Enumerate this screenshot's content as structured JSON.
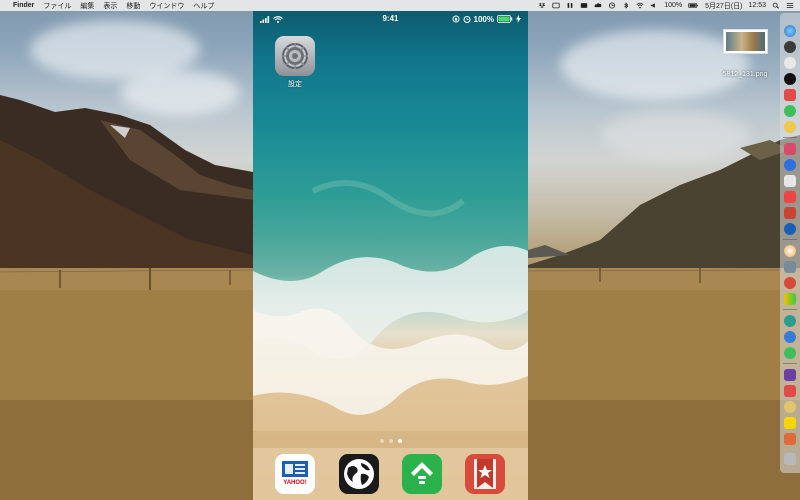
{
  "menubar": {
    "apple": "",
    "app_name": "Finder",
    "menus": [
      "ファイル",
      "編集",
      "表示",
      "移動",
      "ウインドウ",
      "ヘルプ"
    ],
    "battery": "100%",
    "date": "5月27日(日)",
    "time": "12:53"
  },
  "simulator": {
    "status_time": "9:41",
    "battery": "100%",
    "apps": [
      {
        "label": "設定",
        "icon": "settings-gear-icon"
      }
    ],
    "page_dots": 3,
    "active_page": 2,
    "dock_apps": [
      {
        "name": "yahoo-japan-icon",
        "text": "YAHOO!"
      },
      {
        "name": "globe-icon"
      },
      {
        "name": "feedly-icon"
      },
      {
        "name": "wunderlist-icon"
      }
    ]
  },
  "desktop": {
    "file_label": "5812_131.png"
  },
  "colors": {
    "menubar_bg": "#ececec",
    "dock_bg": "#dcdcdc"
  }
}
